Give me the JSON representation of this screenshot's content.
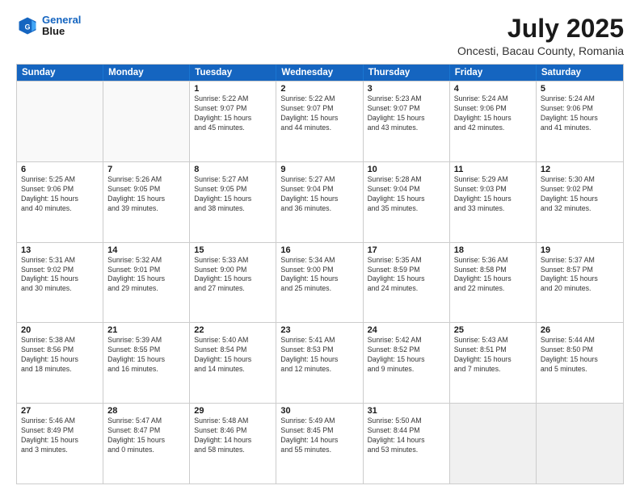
{
  "header": {
    "logo_line1": "General",
    "logo_line2": "Blue",
    "month_year": "July 2025",
    "location": "Oncesti, Bacau County, Romania"
  },
  "days_of_week": [
    "Sunday",
    "Monday",
    "Tuesday",
    "Wednesday",
    "Thursday",
    "Friday",
    "Saturday"
  ],
  "rows": [
    [
      {
        "day": "",
        "lines": [],
        "empty": true
      },
      {
        "day": "",
        "lines": [],
        "empty": true
      },
      {
        "day": "1",
        "lines": [
          "Sunrise: 5:22 AM",
          "Sunset: 9:07 PM",
          "Daylight: 15 hours",
          "and 45 minutes."
        ]
      },
      {
        "day": "2",
        "lines": [
          "Sunrise: 5:22 AM",
          "Sunset: 9:07 PM",
          "Daylight: 15 hours",
          "and 44 minutes."
        ]
      },
      {
        "day": "3",
        "lines": [
          "Sunrise: 5:23 AM",
          "Sunset: 9:07 PM",
          "Daylight: 15 hours",
          "and 43 minutes."
        ]
      },
      {
        "day": "4",
        "lines": [
          "Sunrise: 5:24 AM",
          "Sunset: 9:06 PM",
          "Daylight: 15 hours",
          "and 42 minutes."
        ]
      },
      {
        "day": "5",
        "lines": [
          "Sunrise: 5:24 AM",
          "Sunset: 9:06 PM",
          "Daylight: 15 hours",
          "and 41 minutes."
        ]
      }
    ],
    [
      {
        "day": "6",
        "lines": [
          "Sunrise: 5:25 AM",
          "Sunset: 9:06 PM",
          "Daylight: 15 hours",
          "and 40 minutes."
        ]
      },
      {
        "day": "7",
        "lines": [
          "Sunrise: 5:26 AM",
          "Sunset: 9:05 PM",
          "Daylight: 15 hours",
          "and 39 minutes."
        ]
      },
      {
        "day": "8",
        "lines": [
          "Sunrise: 5:27 AM",
          "Sunset: 9:05 PM",
          "Daylight: 15 hours",
          "and 38 minutes."
        ]
      },
      {
        "day": "9",
        "lines": [
          "Sunrise: 5:27 AM",
          "Sunset: 9:04 PM",
          "Daylight: 15 hours",
          "and 36 minutes."
        ]
      },
      {
        "day": "10",
        "lines": [
          "Sunrise: 5:28 AM",
          "Sunset: 9:04 PM",
          "Daylight: 15 hours",
          "and 35 minutes."
        ]
      },
      {
        "day": "11",
        "lines": [
          "Sunrise: 5:29 AM",
          "Sunset: 9:03 PM",
          "Daylight: 15 hours",
          "and 33 minutes."
        ]
      },
      {
        "day": "12",
        "lines": [
          "Sunrise: 5:30 AM",
          "Sunset: 9:02 PM",
          "Daylight: 15 hours",
          "and 32 minutes."
        ]
      }
    ],
    [
      {
        "day": "13",
        "lines": [
          "Sunrise: 5:31 AM",
          "Sunset: 9:02 PM",
          "Daylight: 15 hours",
          "and 30 minutes."
        ]
      },
      {
        "day": "14",
        "lines": [
          "Sunrise: 5:32 AM",
          "Sunset: 9:01 PM",
          "Daylight: 15 hours",
          "and 29 minutes."
        ]
      },
      {
        "day": "15",
        "lines": [
          "Sunrise: 5:33 AM",
          "Sunset: 9:00 PM",
          "Daylight: 15 hours",
          "and 27 minutes."
        ]
      },
      {
        "day": "16",
        "lines": [
          "Sunrise: 5:34 AM",
          "Sunset: 9:00 PM",
          "Daylight: 15 hours",
          "and 25 minutes."
        ]
      },
      {
        "day": "17",
        "lines": [
          "Sunrise: 5:35 AM",
          "Sunset: 8:59 PM",
          "Daylight: 15 hours",
          "and 24 minutes."
        ]
      },
      {
        "day": "18",
        "lines": [
          "Sunrise: 5:36 AM",
          "Sunset: 8:58 PM",
          "Daylight: 15 hours",
          "and 22 minutes."
        ]
      },
      {
        "day": "19",
        "lines": [
          "Sunrise: 5:37 AM",
          "Sunset: 8:57 PM",
          "Daylight: 15 hours",
          "and 20 minutes."
        ]
      }
    ],
    [
      {
        "day": "20",
        "lines": [
          "Sunrise: 5:38 AM",
          "Sunset: 8:56 PM",
          "Daylight: 15 hours",
          "and 18 minutes."
        ]
      },
      {
        "day": "21",
        "lines": [
          "Sunrise: 5:39 AM",
          "Sunset: 8:55 PM",
          "Daylight: 15 hours",
          "and 16 minutes."
        ]
      },
      {
        "day": "22",
        "lines": [
          "Sunrise: 5:40 AM",
          "Sunset: 8:54 PM",
          "Daylight: 15 hours",
          "and 14 minutes."
        ]
      },
      {
        "day": "23",
        "lines": [
          "Sunrise: 5:41 AM",
          "Sunset: 8:53 PM",
          "Daylight: 15 hours",
          "and 12 minutes."
        ]
      },
      {
        "day": "24",
        "lines": [
          "Sunrise: 5:42 AM",
          "Sunset: 8:52 PM",
          "Daylight: 15 hours",
          "and 9 minutes."
        ]
      },
      {
        "day": "25",
        "lines": [
          "Sunrise: 5:43 AM",
          "Sunset: 8:51 PM",
          "Daylight: 15 hours",
          "and 7 minutes."
        ]
      },
      {
        "day": "26",
        "lines": [
          "Sunrise: 5:44 AM",
          "Sunset: 8:50 PM",
          "Daylight: 15 hours",
          "and 5 minutes."
        ]
      }
    ],
    [
      {
        "day": "27",
        "lines": [
          "Sunrise: 5:46 AM",
          "Sunset: 8:49 PM",
          "Daylight: 15 hours",
          "and 3 minutes."
        ]
      },
      {
        "day": "28",
        "lines": [
          "Sunrise: 5:47 AM",
          "Sunset: 8:47 PM",
          "Daylight: 15 hours",
          "and 0 minutes."
        ]
      },
      {
        "day": "29",
        "lines": [
          "Sunrise: 5:48 AM",
          "Sunset: 8:46 PM",
          "Daylight: 14 hours",
          "and 58 minutes."
        ]
      },
      {
        "day": "30",
        "lines": [
          "Sunrise: 5:49 AM",
          "Sunset: 8:45 PM",
          "Daylight: 14 hours",
          "and 55 minutes."
        ]
      },
      {
        "day": "31",
        "lines": [
          "Sunrise: 5:50 AM",
          "Sunset: 8:44 PM",
          "Daylight: 14 hours",
          "and 53 minutes."
        ]
      },
      {
        "day": "",
        "lines": [],
        "empty": true,
        "shaded": true
      },
      {
        "day": "",
        "lines": [],
        "empty": true,
        "shaded": true
      }
    ]
  ]
}
